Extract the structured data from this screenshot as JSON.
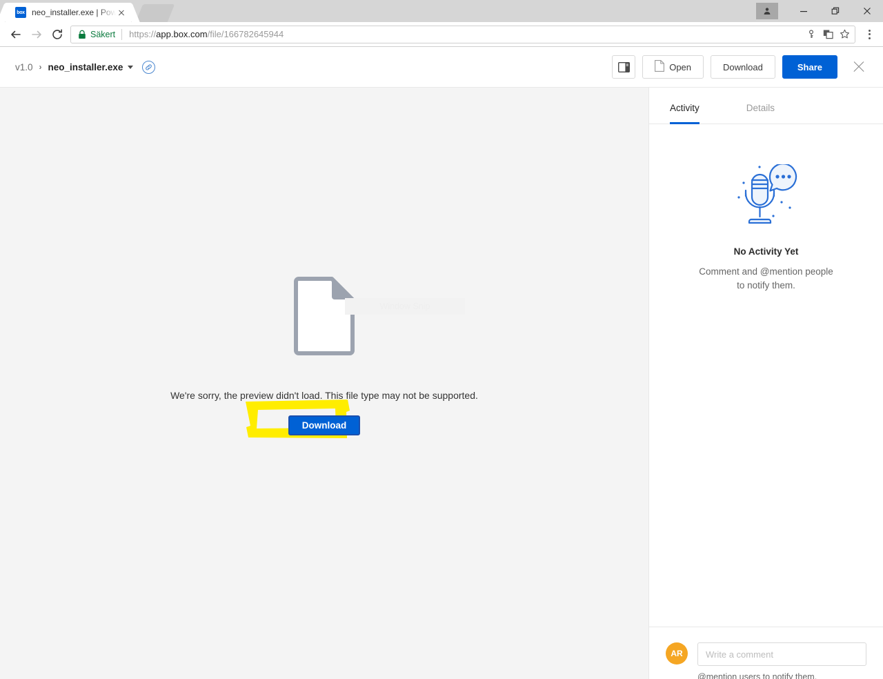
{
  "browser": {
    "tab": {
      "favicon_label": "box",
      "favicon_icon": "box-logo-icon",
      "title": "neo_installer.exe | Powere",
      "close_icon": "close-icon"
    },
    "new_tab_icon": "new-tab-ghost",
    "window_controls": {
      "profile_icon": "person-icon",
      "minimize": "—",
      "maximize": "❐",
      "close": "✕"
    },
    "nav": {
      "back_icon": "back-arrow-icon",
      "forward_icon": "forward-arrow-icon",
      "reload_icon": "reload-icon"
    },
    "omnibox": {
      "lock_icon": "lock-icon",
      "security_label": "Säkert",
      "url_scheme": "https://",
      "url_host": "app.box.com",
      "url_path": "/file/166782645944",
      "url_full": "https://app.box.com/file/166782645944",
      "password_key_icon": "key-icon",
      "translate_icon": "translate-icon",
      "bookmark_icon": "star-icon"
    },
    "menu_icon": "kebab-menu-icon"
  },
  "header": {
    "version": "v1.0",
    "separator": "›",
    "filename": "neo_installer.exe",
    "dropdown_icon": "chevron-down-icon",
    "shared_link_icon": "link-circle-icon",
    "sidebar_toggle_icon": "sidebar-toggle-icon",
    "open_label": "Open",
    "open_icon": "file-icon",
    "download_label": "Download",
    "share_label": "Share",
    "close_icon": "close-icon",
    "share_color": "#0061d5"
  },
  "preview": {
    "watermark": "Window Snip",
    "file_icon": "document-icon",
    "message": "We're sorry, the preview didn't load. This file type may not be supported.",
    "download_label": "Download",
    "download_color": "#0061d5",
    "highlight_color": "#ffed00",
    "background_color": "#f4f4f4",
    "annotation": "yellow-highlighter-marker"
  },
  "sidebar": {
    "tabs": [
      {
        "label": "Activity",
        "active": true
      },
      {
        "label": "Details",
        "active": false
      }
    ],
    "empty_state": {
      "illustration": "microphone-speech-bubble-icon",
      "title": "No Activity Yet",
      "subtitle": "Comment and @mention people to notify them."
    },
    "comment": {
      "avatar_initials": "AR",
      "avatar_color": "#f5a623",
      "placeholder": "Write a comment",
      "value": "",
      "hint": "@mention users to notify them."
    }
  }
}
